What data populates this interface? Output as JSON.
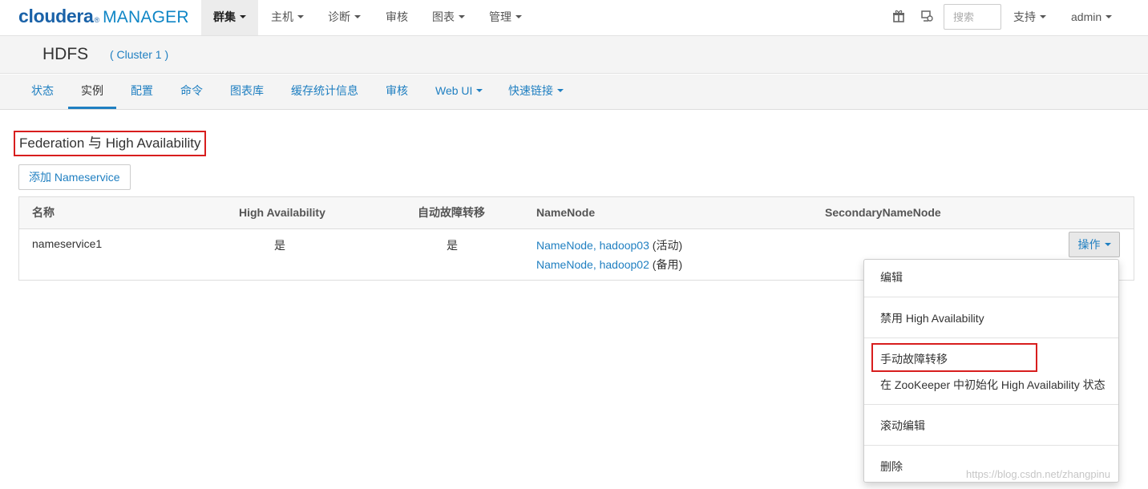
{
  "brand": {
    "logo_main": "cloudera",
    "logo_sub": "MANAGER"
  },
  "topnav": {
    "items": [
      {
        "label": "群集",
        "caret": true,
        "active": true
      },
      {
        "label": "主机",
        "caret": true
      },
      {
        "label": "诊断",
        "caret": true
      },
      {
        "label": "审核",
        "caret": false
      },
      {
        "label": "图表",
        "caret": true
      },
      {
        "label": "管理",
        "caret": true
      }
    ],
    "search_placeholder": "搜索",
    "support_label": "支持",
    "user_label": "admin",
    "icons": [
      "gift-icon",
      "notification-icon"
    ]
  },
  "service": {
    "title": "HDFS",
    "cluster": "( Cluster 1 )"
  },
  "tabs": [
    {
      "label": "状态"
    },
    {
      "label": "实例",
      "active": true
    },
    {
      "label": "配置"
    },
    {
      "label": "命令"
    },
    {
      "label": "图表库"
    },
    {
      "label": "缓存统计信息"
    },
    {
      "label": "审核"
    },
    {
      "label": "Web UI",
      "caret": true
    },
    {
      "label": "快速链接",
      "caret": true
    }
  ],
  "section": {
    "title": "Federation 与 High Availability",
    "add_button": "添加 Nameservice"
  },
  "table": {
    "headers": [
      "名称",
      "High Availability",
      "自动故障转移",
      "NameNode",
      "SecondaryNameNode"
    ],
    "rows": [
      {
        "name": "nameservice1",
        "ha": "是",
        "auto_failover": "是",
        "namenodes": [
          {
            "link": "NameNode, hadoop03",
            "state": "(活动)"
          },
          {
            "link": "NameNode, hadoop02",
            "state": "(备用)"
          }
        ],
        "secondary": "",
        "action_label": "操作"
      }
    ]
  },
  "dropdown": {
    "items": [
      "编辑",
      "禁用 High Availability",
      "手动故障转移",
      "在 ZooKeeper 中初始化 High Availability 状态",
      "滚动编辑",
      "删除"
    ]
  },
  "watermark": "https://blog.csdn.net/zhangpinu",
  "colors": {
    "link": "#1f7fc1",
    "brand": "#1a62a8",
    "highlight_border": "#d81e1e"
  }
}
